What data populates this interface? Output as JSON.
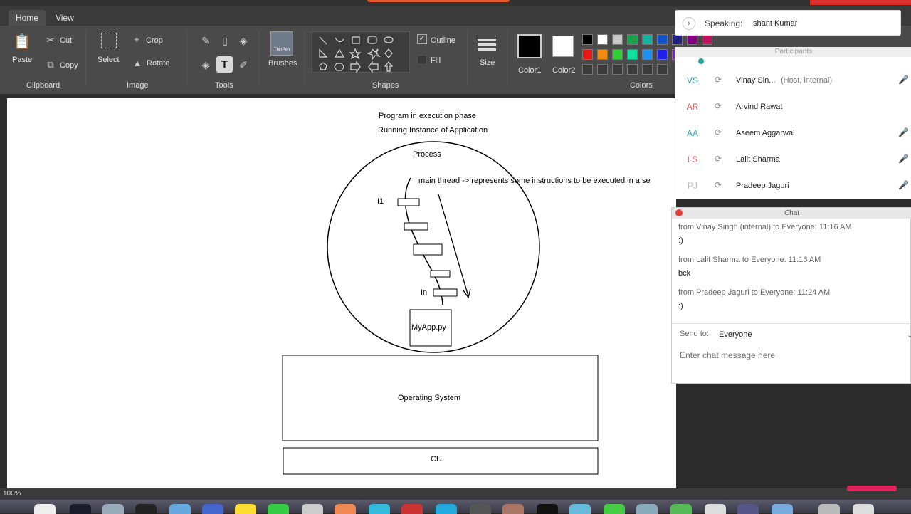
{
  "ribbon": {
    "tabs": [
      {
        "label": "Home"
      },
      {
        "label": "View"
      }
    ],
    "clipboard": {
      "paste": "Paste",
      "cut": "Cut",
      "copy": "Copy",
      "label": "Clipboard"
    },
    "image": {
      "select": "Select",
      "crop": "Crop",
      "rotate": "Rotate",
      "label": "Image"
    },
    "tools": {
      "text_icon": "T",
      "label": "Tools"
    },
    "brushes": {
      "label": "Brushes",
      "thumb": "ThinPen"
    },
    "shapes": {
      "outline": "Outline",
      "fill": "Fill",
      "label": "Shapes"
    },
    "size": {
      "label": "Size"
    },
    "color1": {
      "label": "Color1",
      "value": "#000000"
    },
    "color2": {
      "label": "Color2",
      "value": "#ffffff"
    },
    "colors": {
      "label": "Colors",
      "palette_row1": [
        "#000000",
        "#ffffff",
        "#c8c8c8",
        "#19a04a",
        "#12b3a0",
        "#1050c8",
        "#202080",
        "#800080",
        "#c01060"
      ],
      "palette_row2": [
        "#e81818",
        "#f28c10",
        "#30d030",
        "#10e0a0",
        "#1c90f0",
        "#2020e8",
        "#9010e0"
      ]
    }
  },
  "canvas": {
    "line1": "Program in execution phase",
    "line2": "Running Instance of Application",
    "process": "Process",
    "thread": "main thread -> represents some instructions to be executed in a se",
    "i1": "I1",
    "in": "In",
    "app": "MyApp.py",
    "os": "Operating System",
    "cu": "CU"
  },
  "status": {
    "zoom": "100%"
  },
  "speaking": {
    "label": "Speaking:",
    "name": "Ishant Kumar"
  },
  "participants": {
    "header": "Participants",
    "rows": [
      {
        "initials": "VS",
        "name": "Vinay Sin...",
        "note": "(Host, internal)",
        "color": "#2aa198"
      },
      {
        "initials": "AR",
        "name": "Arvind Rawat",
        "note": "",
        "color": "#d9534f"
      },
      {
        "initials": "AA",
        "name": "Aseem Aggarwal",
        "note": "",
        "color": "#3aa0d0"
      },
      {
        "initials": "LS",
        "name": "Lalit Sharma",
        "note": "",
        "color": "#d9534f"
      },
      {
        "initials": "PJ",
        "name": "Pradeep Jaguri",
        "note": "",
        "color": "#bbbbbb"
      }
    ]
  },
  "chat": {
    "title": "Chat",
    "messages": [
      {
        "meta": "from Vinay Singh (internal) to Everyone:   11:16  AM",
        "text": ":)"
      },
      {
        "meta": "from Lalit Sharma to Everyone:   11:16  AM",
        "text": "bck"
      },
      {
        "meta": "from Pradeep Jaguri to Everyone:   11:24  AM",
        "text": ":)"
      }
    ],
    "send_to_label": "Send to:",
    "send_to_value": "Everyone",
    "placeholder": "Enter chat message here"
  }
}
